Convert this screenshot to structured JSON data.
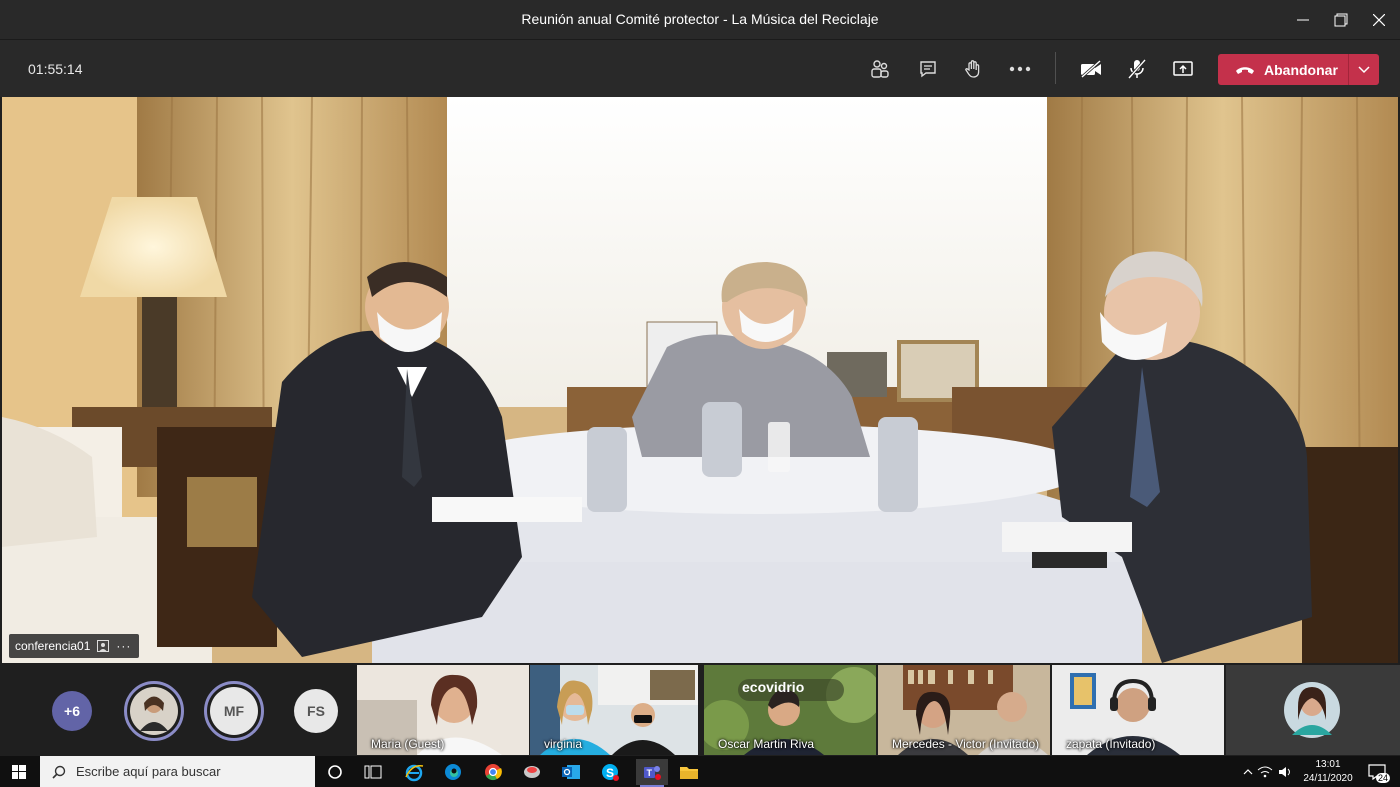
{
  "window": {
    "title": "Reunión anual Comité protector - La Música del Reciclaje"
  },
  "toolbar": {
    "timer": "01:55:14",
    "leave_label": "Abandonar"
  },
  "main_video": {
    "participant_label": "conferencia01",
    "more_glyph": "···"
  },
  "participants": {
    "overflow_count": "+6",
    "initials_1": "MF",
    "initials_2": "FS",
    "tiles": [
      {
        "label": "Maria (Guest)"
      },
      {
        "label": "virginia"
      },
      {
        "label": "Oscar Martin Riva"
      },
      {
        "label": "Mercedes - Victor (Invitado)"
      },
      {
        "label": "zapata (Invitado)"
      }
    ],
    "tile3_sign": "ecovidrio"
  },
  "taskbar": {
    "search_placeholder": "Escribe aquí para buscar",
    "time": "13:01",
    "date": "24/11/2020",
    "notification_count": "24"
  },
  "colors": {
    "leave_red": "#c4314b",
    "ring_purple": "#8b8cc7",
    "overflow_purple": "#6264a7",
    "titlebar": "#292929"
  }
}
